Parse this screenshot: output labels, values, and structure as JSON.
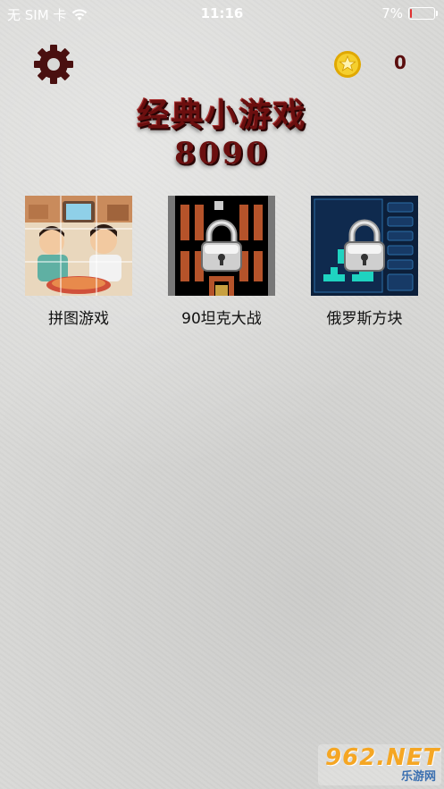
{
  "status_bar": {
    "carrier": "无 SIM 卡",
    "time": "11:16",
    "battery_text": "7%",
    "battery_level": 0.07
  },
  "header": {
    "coin_count": "0"
  },
  "title": "经典小游戏",
  "subtitle": "8090",
  "games": [
    {
      "label": "拼图游戏",
      "locked": false
    },
    {
      "label": "90坦克大战",
      "locked": true
    },
    {
      "label": "俄罗斯方块",
      "locked": true
    }
  ],
  "watermark": {
    "top": "962.NET",
    "bottom": "乐游网"
  },
  "colors": {
    "title": "#6b0f0f",
    "gear": "#4a1010",
    "coin": "#f2c51b",
    "tetris_bg": "#0c1f3a",
    "tank_bg": "#000000"
  },
  "icons": [
    "wifi-icon",
    "battery-icon",
    "gear-icon",
    "coin-icon",
    "lock-icon"
  ]
}
